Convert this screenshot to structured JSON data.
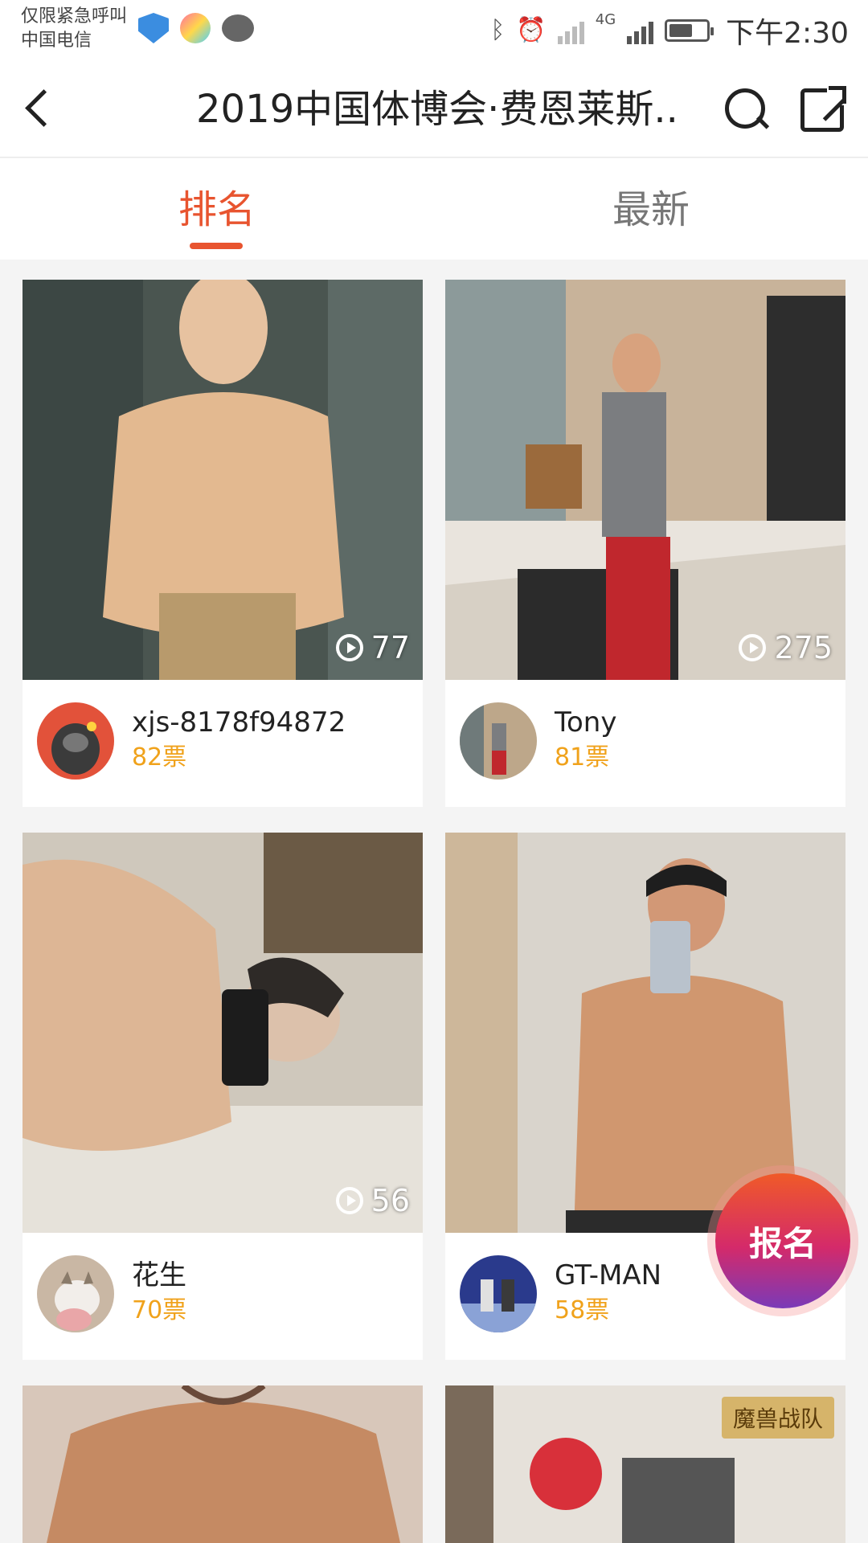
{
  "status_bar": {
    "carrier_line1": "仅限紧急呼叫",
    "carrier_line2": "中国电信",
    "network_label": "4G",
    "time": "下午2:30"
  },
  "header": {
    "title": "2019中国体博会·费恩莱斯...",
    "icons": [
      "back-icon",
      "search-icon",
      "share-icon"
    ]
  },
  "tabs": [
    {
      "label": "排名",
      "active": true
    },
    {
      "label": "最新",
      "active": false
    }
  ],
  "cards": [
    {
      "name": "xjs-8178f94872",
      "votes": "82票",
      "views": "77"
    },
    {
      "name": "Tony",
      "votes": "81票",
      "views": "275"
    },
    {
      "name": "花生",
      "votes": "70票",
      "views": "56"
    },
    {
      "name": "GT-MAN",
      "votes": "58票",
      "views": ""
    }
  ],
  "team_badge": "魔兽战队",
  "signup_button": "报名",
  "colors": {
    "accent": "#e8542f",
    "votes": "#f0a21b"
  }
}
